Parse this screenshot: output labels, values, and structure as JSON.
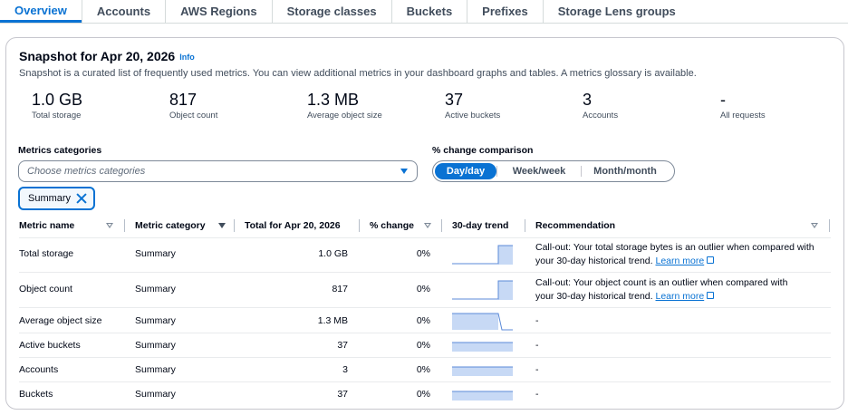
{
  "tabs": [
    "Overview",
    "Accounts",
    "AWS Regions",
    "Storage classes",
    "Buckets",
    "Prefixes",
    "Storage Lens groups"
  ],
  "snapshot": {
    "title": "Snapshot for Apr 20, 2026",
    "info": "Info",
    "description": "Snapshot is a curated list of frequently used metrics. You can view additional metrics in your dashboard graphs and tables. A metrics glossary is available."
  },
  "kpis": [
    {
      "value": "1.0 GB",
      "label": "Total storage"
    },
    {
      "value": "817",
      "label": "Object count"
    },
    {
      "value": "1.3 MB",
      "label": "Average object size"
    },
    {
      "value": "37",
      "label": "Active buckets"
    },
    {
      "value": "3",
      "label": "Accounts"
    },
    {
      "value": "-",
      "label": "All requests"
    }
  ],
  "filters": {
    "metrics_categories_label": "Metrics categories",
    "metrics_categories_placeholder": "Choose metrics categories",
    "change_comparison_label": "% change comparison",
    "change_options": [
      "Day/day",
      "Week/week",
      "Month/month"
    ],
    "selected_change": "Day/day",
    "token": "Summary"
  },
  "table": {
    "headers": [
      "Metric name",
      "Metric category",
      "Total for Apr 20, 2026",
      "% change",
      "30-day trend",
      "Recommendation"
    ],
    "rows": [
      {
        "name": "Total storage",
        "category": "Summary",
        "total": "1.0 GB",
        "change": "0%",
        "trend": "step-up",
        "rec_line1": "Call-out: Your total storage bytes is an outlier when compared with",
        "rec_line2": "your 30-day historical trend.",
        "rec_link": "Learn more"
      },
      {
        "name": "Object count",
        "category": "Summary",
        "total": "817",
        "change": "0%",
        "trend": "step-up",
        "rec_line1": "Call-out: Your object count is an outlier when compared with",
        "rec_line2": "your 30-day historical trend.",
        "rec_link": "Learn more"
      },
      {
        "name": "Average object size",
        "category": "Summary",
        "total": "1.3 MB",
        "change": "0%",
        "trend": "step-down",
        "rec": "-"
      },
      {
        "name": "Active buckets",
        "category": "Summary",
        "total": "37",
        "change": "0%",
        "trend": "flat",
        "rec": "-"
      },
      {
        "name": "Accounts",
        "category": "Summary",
        "total": "3",
        "change": "0%",
        "trend": "flat",
        "rec": "-"
      },
      {
        "name": "Buckets",
        "category": "Summary",
        "total": "37",
        "change": "0%",
        "trend": "flat",
        "rec": "-"
      }
    ]
  },
  "colors": {
    "accent": "#0972d3",
    "spark_fill": "#c7d9f5",
    "spark_line": "#5b8ad8"
  }
}
